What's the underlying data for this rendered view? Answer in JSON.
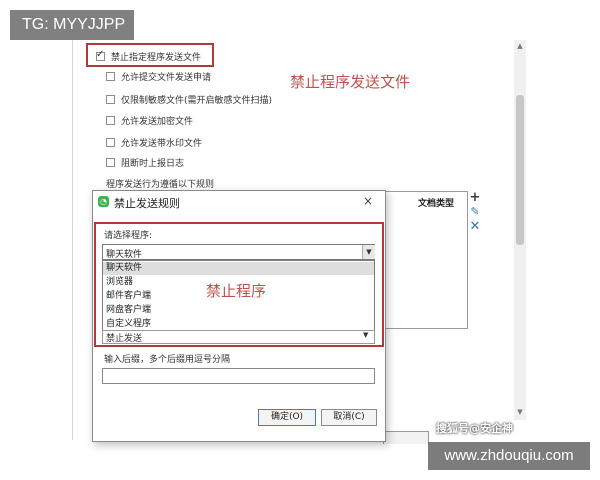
{
  "watermark_top": "TG: MYYJJPP",
  "watermark_source": "搜狐号@安企神",
  "watermark_url": "www.zhdouqiu.com",
  "settings": {
    "options": [
      {
        "label": "禁止指定程序发送文件",
        "checked": true
      },
      {
        "label": "允许提交文件发送申请",
        "checked": false
      },
      {
        "label": "仅限制敏感文件(需开启敏感文件扫描)",
        "checked": false
      },
      {
        "label": "允许发送加密文件",
        "checked": false
      },
      {
        "label": "允许发送带水印文件",
        "checked": false
      },
      {
        "label": "阻断时上报日志",
        "checked": false
      }
    ],
    "rule_label": "程序发送行为遵循以下规则",
    "table_header": "文档类型"
  },
  "annotations": {
    "top": "禁止程序发送文件",
    "dialog": "禁止程序"
  },
  "dialog": {
    "title": "禁止发送规则",
    "close": "×",
    "program_label": "请选择程序:",
    "selected_value": "聊天软件",
    "options": [
      "聊天软件",
      "浏览器",
      "邮件客户端",
      "网盘客户端",
      "自定义程序"
    ],
    "lower_select": "禁止发送",
    "suffix_label": "输入后缀，多个后缀用逗号分隔",
    "suffix_value": "",
    "ok_label": "确定(O)",
    "cancel_label": "取消(C)"
  },
  "colors": {
    "highlight": "#b23a3a",
    "annotation": "#c0504d",
    "icon_blue": "#2a7ab8",
    "app_icon": "#3fb24a"
  },
  "icons": {
    "add": "plus-icon",
    "edit": "pencil-icon",
    "delete": "x-icon",
    "dropdown": "triangle-down-icon"
  }
}
